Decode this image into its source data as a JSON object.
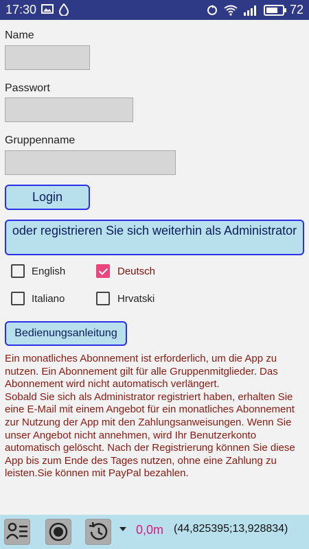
{
  "status_bar": {
    "time": "17:30",
    "battery": "72",
    "battery_level_percent": 72,
    "left_icons": [
      "image-icon",
      "water-drop-icon"
    ],
    "right_icons": [
      "sync-icon",
      "wifi-icon",
      "signal-icon",
      "battery-icon"
    ]
  },
  "form": {
    "name_label": "Name",
    "name_value": "",
    "password_label": "Passwort",
    "password_value": "",
    "group_label": "Gruppenname",
    "group_value": "",
    "login_button": "Login",
    "register_button": "oder registrieren Sie sich weiterhin als Administrator"
  },
  "languages": [
    {
      "label": "English",
      "checked": false
    },
    {
      "label": "Deutsch",
      "checked": true
    },
    {
      "label": "Italiano",
      "checked": false
    },
    {
      "label": "Hrvatski",
      "checked": false
    }
  ],
  "manual_button": "Bedienungsanleitung",
  "info_text": "Ein monatliches Abonnement ist erforderlich, um die App zu nutzen. Ein Abonnement gilt für alle Gruppenmitglieder. Das Abonnement wird nicht automatisch verlängert.\nSobald Sie sich  als Administrator registriert haben, erhalten Sie eine E-Mail mit einem Angebot für ein monatliches Abonnement zur Nutzung der App mit den Zahlungsanweisungen. Wenn Sie unser Angebot nicht annehmen, wird Ihr Benutzerkonto automatisch gelöscht. Nach der Registrierung können Sie diese App bis zum Ende des Tages nutzen, ohne eine Zahlung zu leisten.Sie können mit PayPal bezahlen.",
  "bottom_bar": {
    "icons": [
      "contacts-list-icon",
      "record-icon",
      "history-icon",
      "dropdown-arrow-icon"
    ],
    "distance": "0,0m",
    "coordinates": "(44,825395;13,928834)"
  },
  "colors": {
    "status_bar": "#2f3a86",
    "button_bg": "#b7dfec",
    "button_border": "#2a31e6",
    "info_text": "#8b1a11",
    "checkbox_checked": "#e8467c",
    "distance": "#d4207a"
  }
}
